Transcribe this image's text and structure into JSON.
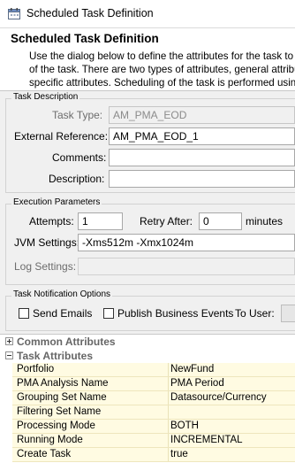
{
  "window": {
    "title": "Scheduled Task Definition",
    "icon": "calendar-icon"
  },
  "header": {
    "title": "Scheduled Task Definition",
    "description_lines": [
      "Use the dialog below to define the attributes for the task to be",
      "of the task.  There are two types of attributes, general attribu",
      "specific attributes.  Scheduling of the task is performed using th"
    ]
  },
  "task_description": {
    "group_label": "Task Description",
    "task_type_label": "Task Type:",
    "task_type_value": "AM_PMA_EOD",
    "external_reference_label": "External Reference:",
    "external_reference_value": "AM_PMA_EOD_1",
    "comments_label": "Comments:",
    "comments_value": "",
    "description_label": "Description:",
    "description_value": ""
  },
  "execution": {
    "group_label": "Execution Parameters",
    "attempts_label": "Attempts:",
    "attempts_value": "1",
    "retry_after_label": "Retry After:",
    "retry_after_value": "0",
    "minutes_label": "minutes",
    "jvm_settings_label": "JVM Settings:",
    "jvm_settings_value": "-Xms512m -Xmx1024m",
    "log_settings_label": "Log Settings:",
    "log_settings_value": ""
  },
  "notification": {
    "group_label": "Task Notification Options",
    "send_emails_label": "Send Emails",
    "send_emails_checked": false,
    "publish_events_label": "Publish Business Events",
    "publish_events_checked": false,
    "to_user_label": "To User:"
  },
  "attributes": {
    "common_label": "Common Attributes",
    "task_label": "Task Attributes",
    "rows": [
      {
        "name": "Portfolio",
        "value": "NewFund"
      },
      {
        "name": "PMA Analysis Name",
        "value": "PMA Period"
      },
      {
        "name": "Grouping Set Name",
        "value": "Datasource/Currency"
      },
      {
        "name": "Filtering Set Name",
        "value": ""
      },
      {
        "name": "Processing Mode",
        "value": "BOTH"
      },
      {
        "name": "Running Mode",
        "value": "INCREMENTAL"
      },
      {
        "name": "Create Task",
        "value": "true"
      }
    ]
  }
}
